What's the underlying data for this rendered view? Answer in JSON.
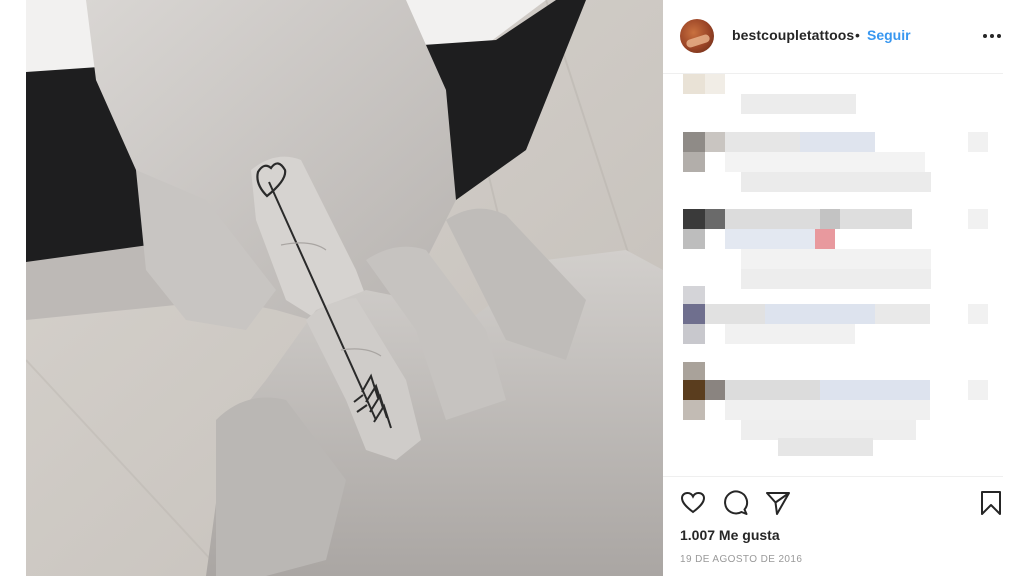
{
  "header": {
    "username": "bestcoupletattoos",
    "separator": "•",
    "follow_label": "Seguir",
    "more_label": "•••"
  },
  "post": {
    "likes_text": "1.007 Me gusta",
    "date_text": "19 DE AGOSTO DE 2016"
  },
  "icons": {
    "like": "heart-icon",
    "comment": "comment-icon",
    "share": "share-icon",
    "save": "bookmark-icon",
    "options": "more-options-icon"
  },
  "colors": {
    "link_blue": "#3897f0",
    "text": "#262626",
    "muted": "#999999",
    "divider": "#efefef"
  }
}
